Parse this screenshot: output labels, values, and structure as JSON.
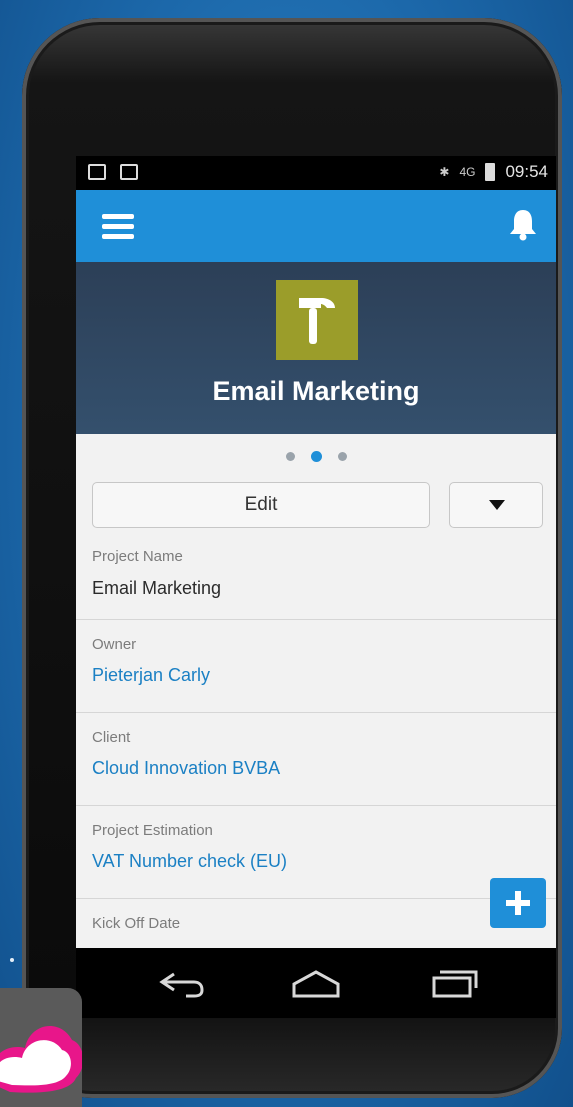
{
  "status_bar": {
    "time": "09:54",
    "network": "4G"
  },
  "header": {
    "menu_icon": "hamburger-menu-icon",
    "notification_icon": "bell-icon"
  },
  "record": {
    "icon": "hammer-icon",
    "title": "Email Marketing",
    "icon_color": "#9b9d2a"
  },
  "pager": {
    "count": 3,
    "active": 2
  },
  "actions": {
    "edit_label": "Edit",
    "more_icon": "caret-down-icon"
  },
  "fields": [
    {
      "label": "Project Name",
      "value": "Email Marketing",
      "link": false
    },
    {
      "label": "Owner",
      "value": "Pieterjan Carly",
      "link": true
    },
    {
      "label": "Client",
      "value": "Cloud Innovation BVBA",
      "link": true
    },
    {
      "label": "Project Estimation",
      "value": "VAT Number check (EU)",
      "link": true
    },
    {
      "label": "Kick Off Date",
      "value": "",
      "link": false
    }
  ],
  "fab": {
    "icon": "plus-icon"
  },
  "nav": {
    "back_icon": "back-icon",
    "home_icon": "home-icon",
    "recents_icon": "recents-icon"
  },
  "colors": {
    "accent": "#1f8fd8",
    "hero": "#2c3f57",
    "link": "#1b80c4",
    "brand": "#e8168a"
  }
}
